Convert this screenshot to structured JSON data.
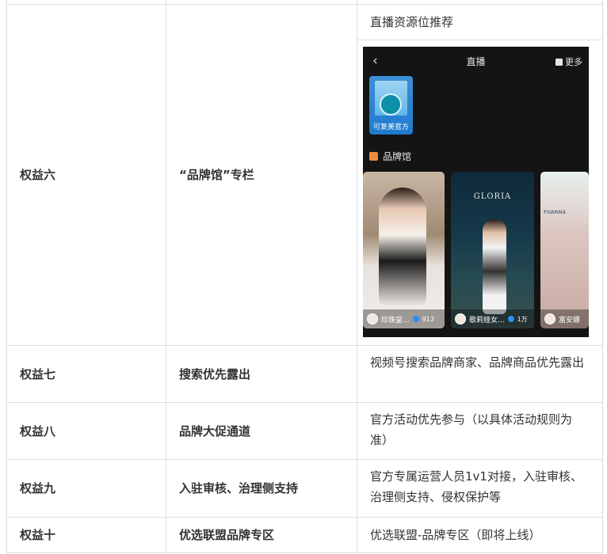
{
  "rows": [
    {
      "rights": "权益六",
      "name": "“品牌馆”专栏",
      "desc": "直播资源位推荐"
    },
    {
      "rights": "权益七",
      "name": "搜索优先露出",
      "desc": "视频号搜索品牌商家、品牌商品优先露出"
    },
    {
      "rights": "权益八",
      "name": "品牌大促通道",
      "desc": "官方活动优先参与（以具体活动规则为准）"
    },
    {
      "rights": "权益九",
      "name": "入驻审核、治理侧支持",
      "desc": "官方专属运营人员1v1对接，入驻审核、治理侧支持、侵权保护等"
    },
    {
      "rights": "权益十",
      "name": "优选联盟品牌专区",
      "desc": "优选联盟-品牌专区（即将上线）"
    }
  ],
  "phone": {
    "back": "‹",
    "title": "直播",
    "more": "更多",
    "brand_card_label": "可复美官方",
    "pavilion_label": "品牌馆",
    "cards": [
      {
        "name": "珍珠皇...",
        "count": "913"
      },
      {
        "name": "歌莉娅女...",
        "count": "1万",
        "logo": "GLORIA"
      },
      {
        "name": "富安娜",
        "logo": "FUANNA"
      }
    ]
  }
}
